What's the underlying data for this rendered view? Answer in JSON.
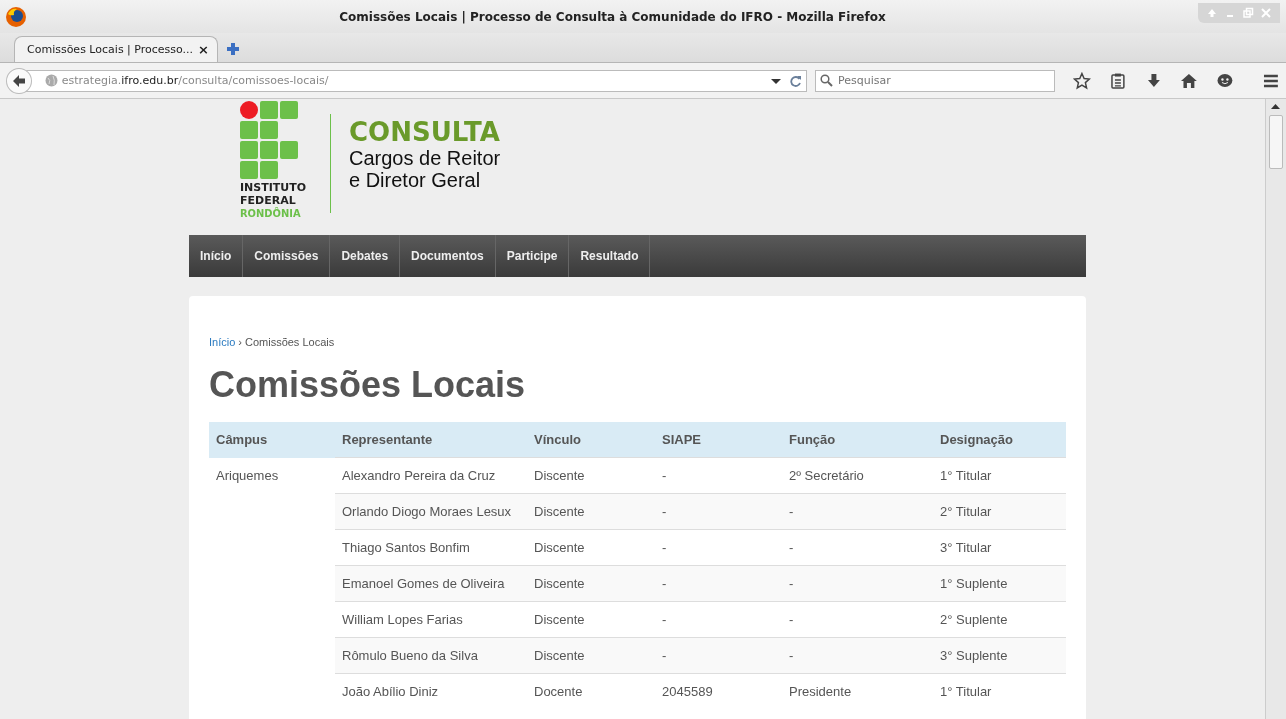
{
  "window": {
    "title": "Comissões Locais | Processo de Consulta à Comunidade do IFRO - Mozilla Firefox"
  },
  "tab": {
    "title": "Comissões Locais | Processo...",
    "close": "×"
  },
  "address_bar": {
    "url_prefix": "estrategia.",
    "url_host": "ifro.edu.br",
    "url_path": "/consulta/comissoes-locais/"
  },
  "search": {
    "placeholder": "Pesquisar"
  },
  "logo": {
    "line_1": "INSTITUTO",
    "line_2": "FEDERAL",
    "line_3": "RONDÔNIA"
  },
  "site_title": {
    "heading": "CONSULTA",
    "subtitle_1": "Cargos de Reitor",
    "subtitle_2": "e Diretor Geral"
  },
  "nav": [
    "Início",
    "Comissões",
    "Debates",
    "Documentos",
    "Participe",
    "Resultado"
  ],
  "breadcrumb": {
    "link": "Início",
    "separator": "›",
    "current": "Comissões Locais"
  },
  "heading": "Comissões Locais",
  "table": {
    "columns": [
      "Câmpus",
      "Representante",
      "Vínculo",
      "SIAPE",
      "Função",
      "Designação"
    ],
    "groups": [
      {
        "campus": "Ariquemes",
        "rows": [
          [
            "Alexandro Pereira da Cruz",
            "Discente",
            "-",
            "2º Secretário",
            "1° Titular"
          ],
          [
            "Orlando Diogo Moraes Lesux",
            "Discente",
            "-",
            "-",
            "2° Titular"
          ],
          [
            "Thiago Santos Bonfim",
            "Discente",
            "-",
            "-",
            "3° Titular"
          ],
          [
            "Emanoel Gomes de Oliveira",
            "Discente",
            "-",
            "-",
            "1° Suplente"
          ],
          [
            "William Lopes Farias",
            "Discente",
            "-",
            "-",
            "2° Suplente"
          ],
          [
            "Rômulo Bueno da Silva",
            "Discente",
            "-",
            "-",
            "3° Suplente"
          ],
          [
            "João Abílio Diniz",
            "Docente",
            "2045589",
            "Presidente",
            "1° Titular"
          ]
        ]
      }
    ]
  }
}
